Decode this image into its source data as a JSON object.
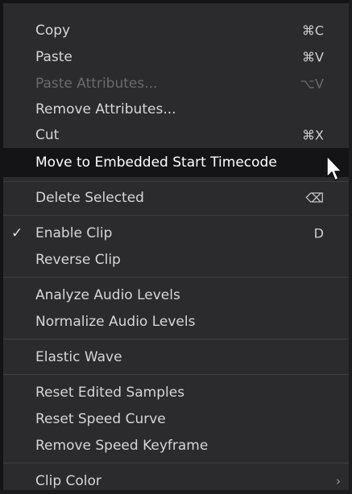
{
  "menu": {
    "group1": [
      {
        "label": "Copy",
        "shortcut": "⌘C"
      },
      {
        "label": "Paste",
        "shortcut": "⌘V"
      },
      {
        "label": "Paste Attributes...",
        "shortcut": "⌥V",
        "disabled": true
      },
      {
        "label": "Remove Attributes...",
        "shortcut": ""
      },
      {
        "label": "Cut",
        "shortcut": "⌘X"
      },
      {
        "label": "Move to Embedded Start Timecode",
        "shortcut": "",
        "highlighted": true
      }
    ],
    "group2": [
      {
        "label": "Delete Selected",
        "shortcut": "⌫"
      }
    ],
    "group3": [
      {
        "label": "Enable Clip",
        "shortcut": "D",
        "checked": true,
        "check_mark": "✓"
      },
      {
        "label": "Reverse Clip",
        "shortcut": ""
      }
    ],
    "group4": [
      {
        "label": "Analyze Audio Levels"
      },
      {
        "label": "Normalize Audio Levels"
      }
    ],
    "group5": [
      {
        "label": "Elastic Wave"
      }
    ],
    "group6": [
      {
        "label": "Reset Edited Samples"
      },
      {
        "label": "Reset Speed Curve"
      },
      {
        "label": "Remove Speed Keyframe"
      }
    ],
    "group7": [
      {
        "label": "Clip Color",
        "submenu_arrow": "›"
      }
    ]
  },
  "colors": {
    "menu_bg": "#2b2b2d",
    "highlight_bg": "#141416",
    "text": "#d6d6d6",
    "disabled_text": "#6a6a6c",
    "separator": "#3d3d40"
  },
  "icons": {
    "cursor": "arrow-pointer-icon",
    "delete": "backspace-icon",
    "check": "checkmark-icon",
    "submenu": "chevron-right-icon"
  }
}
